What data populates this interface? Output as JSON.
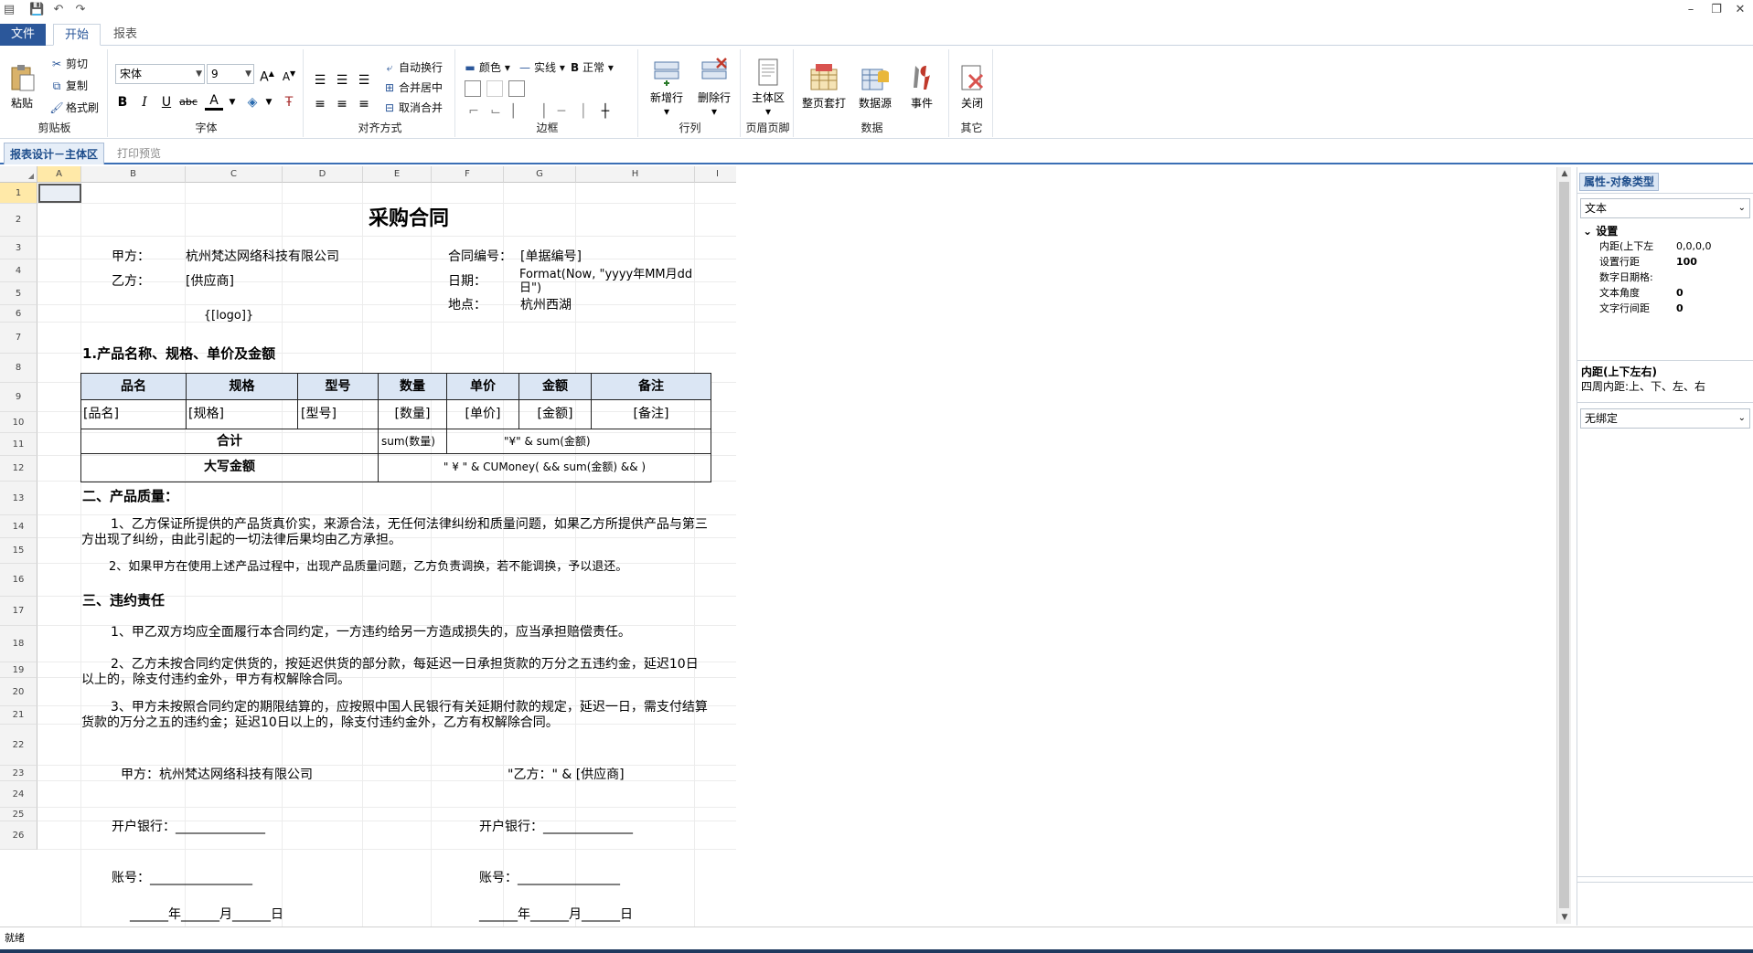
{
  "toolbar": {
    "file_tab": "文件",
    "start_tab": "开始",
    "report_tab": "报表"
  },
  "ribbon": {
    "clipboard": {
      "label": "剪贴板",
      "paste": "粘贴",
      "cut": "剪切",
      "copy": "复制",
      "format_painter": "格式刷"
    },
    "font": {
      "label": "字体",
      "font_name": "宋体",
      "font_size": "9",
      "bold": "B",
      "italic": "I",
      "underline": "U",
      "strike": "abc",
      "color": "A",
      "increase": "A",
      "decrease": "A"
    },
    "align": {
      "label": "对齐方式",
      "wrap": "自动换行",
      "merge_center": "合并居中",
      "unmerge": "取消合并"
    },
    "border": {
      "label": "边框",
      "color": "颜色",
      "line": "实线",
      "weight_b": "B",
      "weight": "正常"
    },
    "rowcol": {
      "label": "行列",
      "add_row": "新增行",
      "del_row": "删除行"
    },
    "header": {
      "label": "页眉页脚",
      "main_area": "主体区"
    },
    "data": {
      "label": "数据",
      "page_template": "整页套打",
      "datasource": "数据源",
      "event": "事件"
    },
    "other": {
      "label": "其它",
      "close": "关闭"
    }
  },
  "doc_tabs": {
    "design": "报表设计－主体区",
    "preview": "打印预览"
  },
  "columns": [
    "A",
    "B",
    "C",
    "D",
    "E",
    "F",
    "G",
    "H",
    "I"
  ],
  "rows": [
    "1",
    "2",
    "3",
    "4",
    "5",
    "6",
    "7",
    "8",
    "9",
    "10",
    "11",
    "12",
    "13",
    "14",
    "15",
    "16",
    "17",
    "18",
    "19",
    "20",
    "21",
    "22",
    "23",
    "24",
    "25",
    "26"
  ],
  "contract": {
    "title": "采购合同",
    "party_a_label": "甲方：",
    "party_a": "杭州梵达网络科技有限公司",
    "contract_no_label": "合同编号：",
    "contract_no": "[单据编号]",
    "party_b_label": "乙方：",
    "party_b": "[供应商]",
    "date_label": "日期：",
    "date_value": "Format(Now, \"yyyy年MM月dd日\")",
    "logo": "{[logo]}",
    "place_label": "地点：",
    "place": "杭州西湖",
    "section1": "1.产品名称、规格、单价及金额",
    "table_headers": [
      "品名",
      "规格",
      "型号",
      "数量",
      "单价",
      "金额",
      "备注"
    ],
    "table_row": [
      "[品名]",
      "[规格]",
      "[型号]",
      "[数量]",
      "[单价]",
      "[金额]",
      "[备注]"
    ],
    "total_label": "合计",
    "total_qty": "sum(数量)",
    "total_amount": "\"¥\" & sum(金额)",
    "capital_label": "大写金额",
    "capital_value": "\" ¥ \" & CUMoney( && sum(金额) && )",
    "section2": "二、产品质量：",
    "q1": "1、乙方保证所提供的产品货真价实，来源合法，无任何法律纠纷和质量问题，如果乙方所提供产品与第三方出现了纠纷，由此引起的一切法律后果均由乙方承担。",
    "q2": "2、如果甲方在使用上述产品过程中，出现产品质量问题，乙方负责调换，若不能调换，予以退还。",
    "section3": "三、违约责任",
    "v1": "1、甲乙双方均应全面履行本合同约定，一方违约给另一方造成损失的，应当承担赔偿责任。",
    "v2": "2、乙方未按合同约定供货的，按延迟供货的部分款，每延迟一日承担货款的万分之五违约金，延迟10日以上的，除支付违约金外，甲方有权解除合同。",
    "v3": "3、甲方未按照合同约定的期限结算的，应按照中国人民银行有关延期付款的规定，延迟一日，需支付结算货款的万分之五的违约金；延迟10日以上的，除支付违约金外，乙方有权解除合同。",
    "sign_a": "甲方：杭州梵达网络科技有限公司",
    "sign_b": "\"乙方：\" & [供应商]",
    "bank_a": "开户银行：______________",
    "bank_b": "开户银行：______________",
    "acct_a": "账号：________________",
    "acct_b": "账号：________________",
    "date_a": "______年______月______日",
    "date_b": "______年______月______日"
  },
  "properties": {
    "title": "属性-对象类型",
    "type": "文本",
    "group": "设置",
    "items": [
      {
        "label": "内距(上下左",
        "value": "0,0,0,0"
      },
      {
        "label": "设置行距",
        "value": "100"
      },
      {
        "label": "数字日期格:",
        "value": ""
      },
      {
        "label": "文本角度",
        "value": "0"
      },
      {
        "label": "文字行间距",
        "value": "0"
      }
    ],
    "desc_title": "内距(上下左右)",
    "desc_text": "四周内距:上、下、左、右",
    "binding": "无绑定"
  },
  "status": {
    "text": "就绪"
  }
}
